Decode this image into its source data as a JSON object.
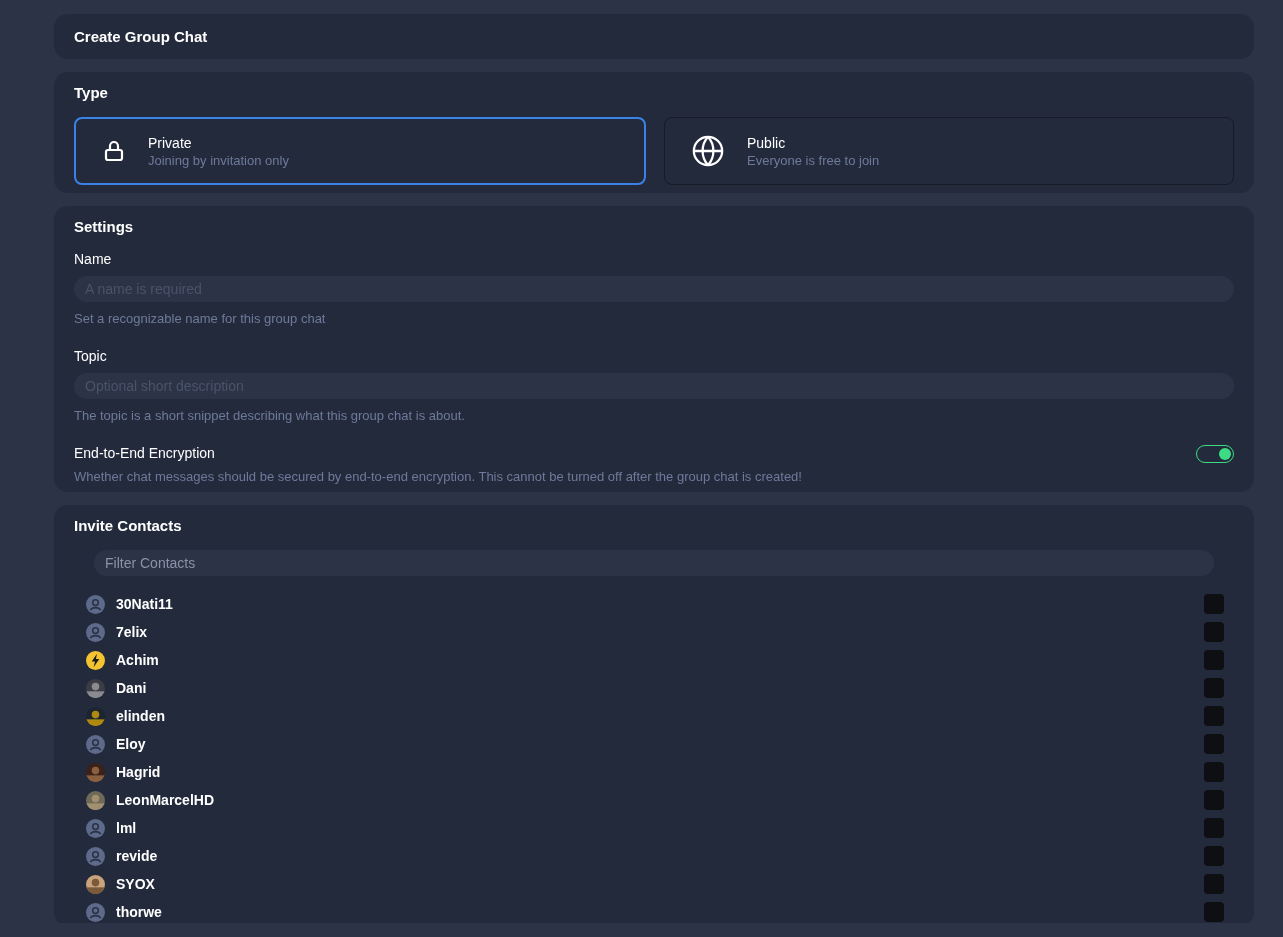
{
  "title": "Create Group Chat",
  "type_section": {
    "heading": "Type",
    "options": [
      {
        "kind": "lock",
        "label": "Private",
        "description": "Joining by invitation only",
        "selected": true
      },
      {
        "kind": "globe",
        "label": "Public",
        "description": "Everyone is free to join",
        "selected": false
      }
    ]
  },
  "settings": {
    "heading": "Settings",
    "fields": [
      {
        "label": "Name",
        "placeholder": "A name is required",
        "help": "Set a recognizable name for this group chat"
      },
      {
        "label": "Topic",
        "placeholder": "Optional short description",
        "help": "The topic is a short snippet describing what this group chat is about."
      }
    ],
    "encryption": {
      "label": "End-to-End Encryption",
      "help": "Whether chat messages should be secured by end-to-end encryption. This cannot be turned off after the group chat is created!",
      "on": true
    }
  },
  "invite": {
    "heading": "Invite Contacts",
    "filter": {
      "placeholder": "Filter Contacts"
    },
    "contacts": [
      {
        "name": "30Nati11",
        "kind": "default",
        "checked": false
      },
      {
        "name": "7elix",
        "kind": "default",
        "checked": false
      },
      {
        "name": "Achim",
        "kind": "bolt",
        "checked": false
      },
      {
        "name": "Dani",
        "kind": "picture",
        "checked": false
      },
      {
        "name": "elinden",
        "kind": "picture",
        "checked": false
      },
      {
        "name": "Eloy",
        "kind": "default",
        "checked": false
      },
      {
        "name": "Hagrid",
        "kind": "picture",
        "checked": false
      },
      {
        "name": "LeonMarcelHD",
        "kind": "picture",
        "checked": false
      },
      {
        "name": "lml",
        "kind": "default",
        "checked": false
      },
      {
        "name": "revide",
        "kind": "default",
        "checked": false
      },
      {
        "name": "SYOX",
        "kind": "picture",
        "checked": false
      },
      {
        "name": "thorwe",
        "kind": "default",
        "checked": false
      }
    ]
  }
}
